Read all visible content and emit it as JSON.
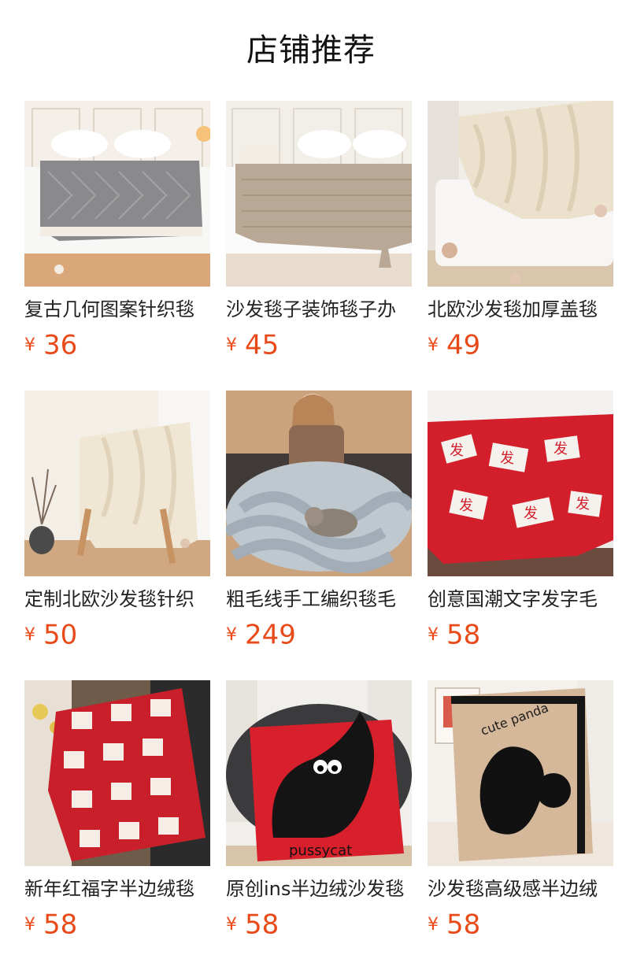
{
  "header": {
    "title": "店铺推荐"
  },
  "products": [
    {
      "name": "复古几何图案针织毯",
      "currency": "¥",
      "price": "36",
      "image": "bed-gray-knit-blanket"
    },
    {
      "name": "沙发毯子装饰毯子办",
      "currency": "¥",
      "price": "45",
      "image": "bed-beige-knit-blanket"
    },
    {
      "name": "北欧沙发毯加厚盖毯",
      "currency": "¥",
      "price": "49",
      "image": "sofa-cream-cable-blanket"
    },
    {
      "name": "定制北欧沙发毯针织",
      "currency": "¥",
      "price": "50",
      "image": "chair-cream-cable-blanket"
    },
    {
      "name": "粗毛线手工编织毯毛",
      "currency": "¥",
      "price": "249",
      "image": "woman-chunky-gray-blanket"
    },
    {
      "name": "创意国潮文字发字毛",
      "currency": "¥",
      "price": "58",
      "image": "bed-red-character-blanket"
    },
    {
      "name": "新年红福字半边绒毯",
      "currency": "¥",
      "price": "58",
      "image": "chair-red-fu-blanket"
    },
    {
      "name": "原创ins半边绒沙发毯",
      "currency": "¥",
      "price": "58",
      "image": "sofa-red-cat-blanket"
    },
    {
      "name": "沙发毯高级感半边绒",
      "currency": "¥",
      "price": "58",
      "image": "cute-panda-blanket"
    }
  ]
}
